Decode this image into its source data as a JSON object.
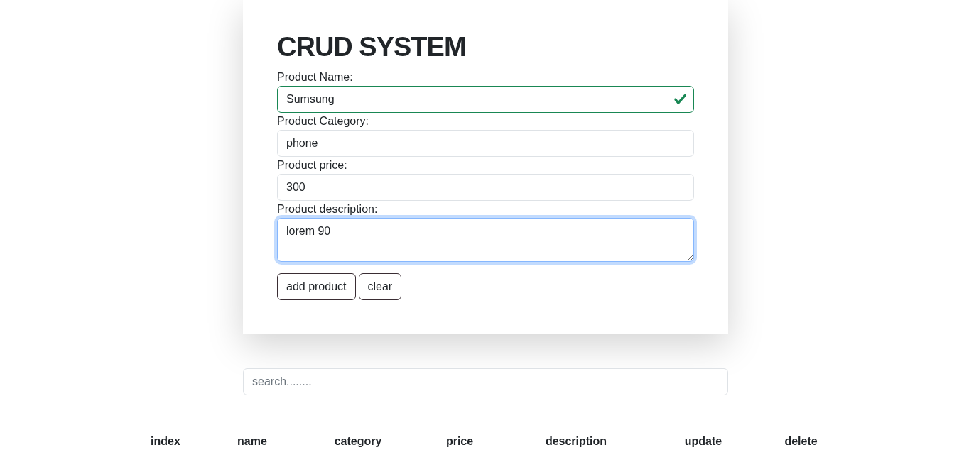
{
  "title": "CRUD SYSTEM",
  "form": {
    "fields": [
      {
        "kind": "input",
        "label": "Product Name:",
        "value": "Sumsung",
        "valid": true,
        "focused": false
      },
      {
        "kind": "input",
        "label": "Product Category:",
        "value": "phone",
        "valid": false,
        "focused": false
      },
      {
        "kind": "input",
        "label": "Product price:",
        "value": "300",
        "valid": false,
        "focused": false
      },
      {
        "kind": "textarea",
        "label": "Product description:",
        "value": "lorem 90",
        "valid": false,
        "focused": true
      }
    ],
    "buttons": [
      "add product",
      "clear"
    ]
  },
  "search": {
    "placeholder": "search........"
  },
  "table": {
    "columns": [
      "index",
      "name",
      "category",
      "price",
      "description",
      "update",
      "delete"
    ]
  }
}
